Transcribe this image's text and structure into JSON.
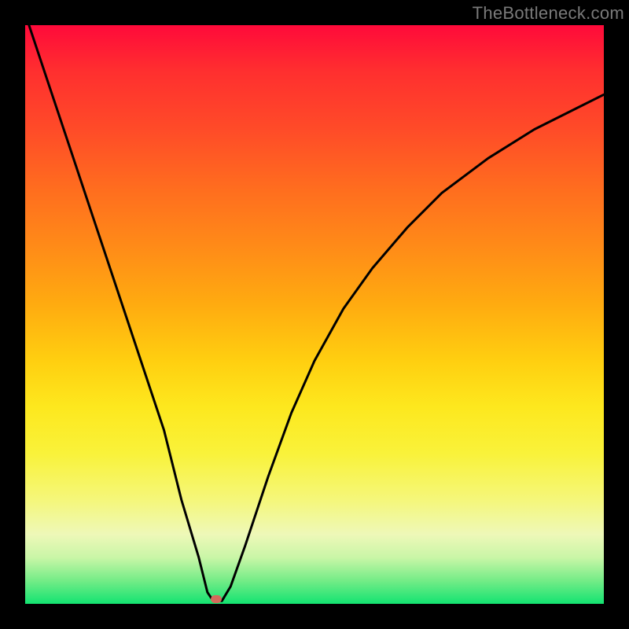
{
  "watermark": "TheBottleneck.com",
  "chart_data": {
    "type": "line",
    "title": "",
    "xlabel": "",
    "ylabel": "",
    "xlim": [
      0,
      100
    ],
    "ylim": [
      0,
      100
    ],
    "series": [
      {
        "name": "bottleneck-curve",
        "x": [
          0,
          4,
          8,
          12,
          16,
          20,
          24,
          27,
          30,
          31.5,
          32.5,
          34,
          35.5,
          38,
          42,
          46,
          50,
          55,
          60,
          66,
          72,
          80,
          88,
          96,
          100
        ],
        "y": [
          102,
          90,
          78,
          66,
          54,
          42,
          30,
          18,
          8,
          2,
          0.5,
          0.5,
          3,
          10,
          22,
          33,
          42,
          51,
          58,
          65,
          71,
          77,
          82,
          86,
          88
        ]
      }
    ],
    "marker": {
      "x": 33.0,
      "y": 0.8
    },
    "colors": {
      "background_top": "#ff0a3a",
      "background_bottom": "#13e371",
      "curve": "#000000",
      "marker": "#d46a5b",
      "frame": "#000000"
    }
  }
}
